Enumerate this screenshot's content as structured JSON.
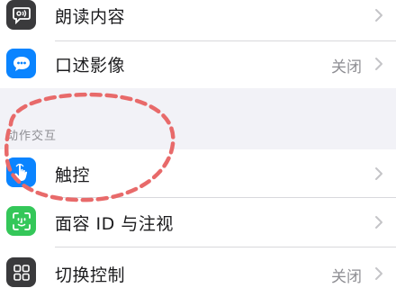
{
  "top_group": {
    "items": [
      {
        "label": "朗读内容",
        "value": "",
        "icon": "speech-bubble-icon",
        "icon_color": "#3a3a3c"
      },
      {
        "label": "口述影像",
        "value": "关闭",
        "icon": "chat-bubble-icon",
        "icon_color": "#0a84ff"
      }
    ]
  },
  "interaction_section": {
    "header": "动作交互",
    "items": [
      {
        "label": "触控",
        "value": "",
        "icon": "hand-pointer-icon",
        "icon_color": "#0a84ff"
      },
      {
        "label": "面容 ID 与注视",
        "value": "",
        "icon": "face-id-icon",
        "icon_color": "#34c759"
      },
      {
        "label": "切换控制",
        "value": "关闭",
        "icon": "grid-icon",
        "icon_color": "#3a3a3c"
      }
    ]
  },
  "annotation": {
    "shape": "dashed-oval",
    "color": "#e86a6a"
  }
}
